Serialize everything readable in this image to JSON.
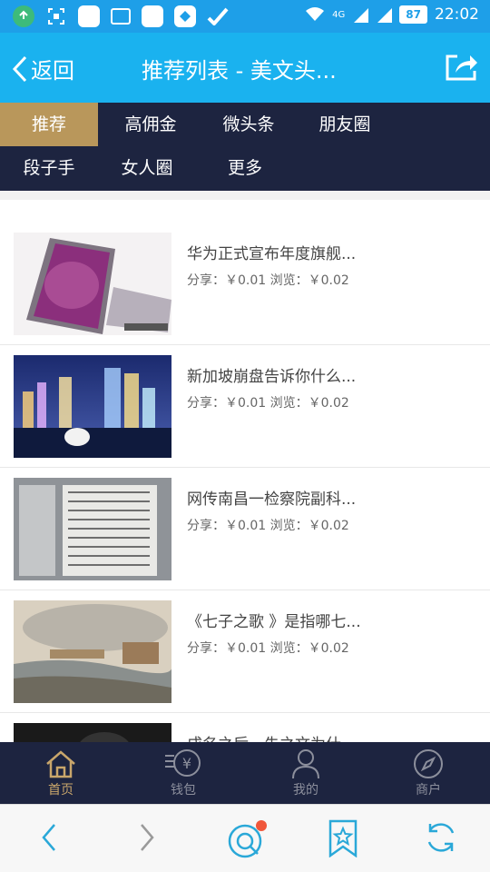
{
  "status_bar": {
    "network": "4G",
    "battery": "87",
    "time": "22:02"
  },
  "header": {
    "back_label": "返回",
    "title": "推荐列表 - 美文头..."
  },
  "categories": [
    {
      "label": "推荐",
      "active": true
    },
    {
      "label": "高佣金",
      "active": false
    },
    {
      "label": "微头条",
      "active": false
    },
    {
      "label": "朋友圈",
      "active": false
    },
    {
      "label": "段子手",
      "active": false
    },
    {
      "label": "女人圈",
      "active": false
    },
    {
      "label": "更多",
      "active": false
    }
  ],
  "articles": [
    {
      "title": "华为正式宣布年度旗舰...",
      "meta": "分享：￥0.01 浏览：￥0.02",
      "thumb": "phone"
    },
    {
      "title": "新加坡崩盘告诉你什么...",
      "meta": "分享：￥0.01 浏览：￥0.02",
      "thumb": "city-night"
    },
    {
      "title": "网传南昌一检察院副科...",
      "meta": "分享：￥0.01 浏览：￥0.02",
      "thumb": "document"
    },
    {
      "title": "《七子之歌 》是指哪七...",
      "meta": "分享：￥0.01 浏览：￥0.02",
      "thumb": "painting"
    },
    {
      "title": "成名之后，朱之文为什...",
      "meta": "",
      "thumb": "dark-photo"
    }
  ],
  "tabbar": [
    {
      "label": "首页",
      "icon": "home-icon",
      "active": true
    },
    {
      "label": "钱包",
      "icon": "wallet-icon",
      "active": false
    },
    {
      "label": "我的",
      "icon": "user-icon",
      "active": false
    },
    {
      "label": "商户",
      "icon": "compass-icon",
      "active": false
    }
  ],
  "colors": {
    "status_bar": "#1e9fe8",
    "header": "#1ab2ef",
    "nav_dark": "#1d2440",
    "accent_gold": "#b9975b",
    "browser_icon": "#2aa8d8"
  }
}
